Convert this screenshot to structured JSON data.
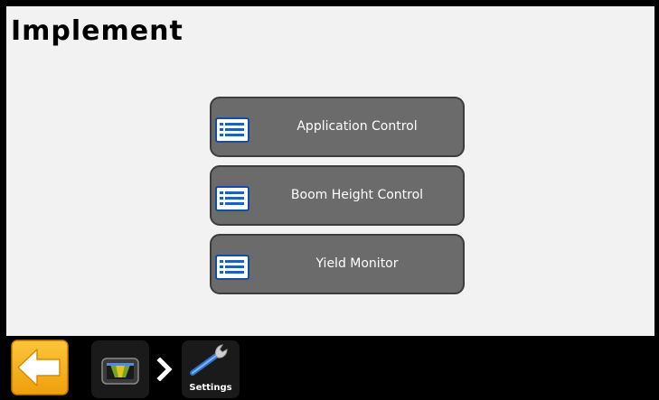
{
  "page": {
    "title": "Implement"
  },
  "menu": {
    "items": [
      {
        "label": "Application Control",
        "icon": "list-icon"
      },
      {
        "label": "Boom Height Control",
        "icon": "list-icon"
      },
      {
        "label": "Yield Monitor",
        "icon": "list-icon"
      }
    ]
  },
  "toolbar": {
    "back_icon": "back-arrow-icon",
    "home_icon": "display-icon",
    "breadcrumb_icon": "chevron-right-icon",
    "settings_label": "Settings",
    "settings_icon": "wrench-icon"
  },
  "colors": {
    "background": "#000000",
    "panel": "#f2f2f2",
    "button": "#6b6b6b",
    "button_border": "#3d3d3d",
    "back_button": "#f5b21b",
    "icon_blue": "#1f5fc2"
  }
}
